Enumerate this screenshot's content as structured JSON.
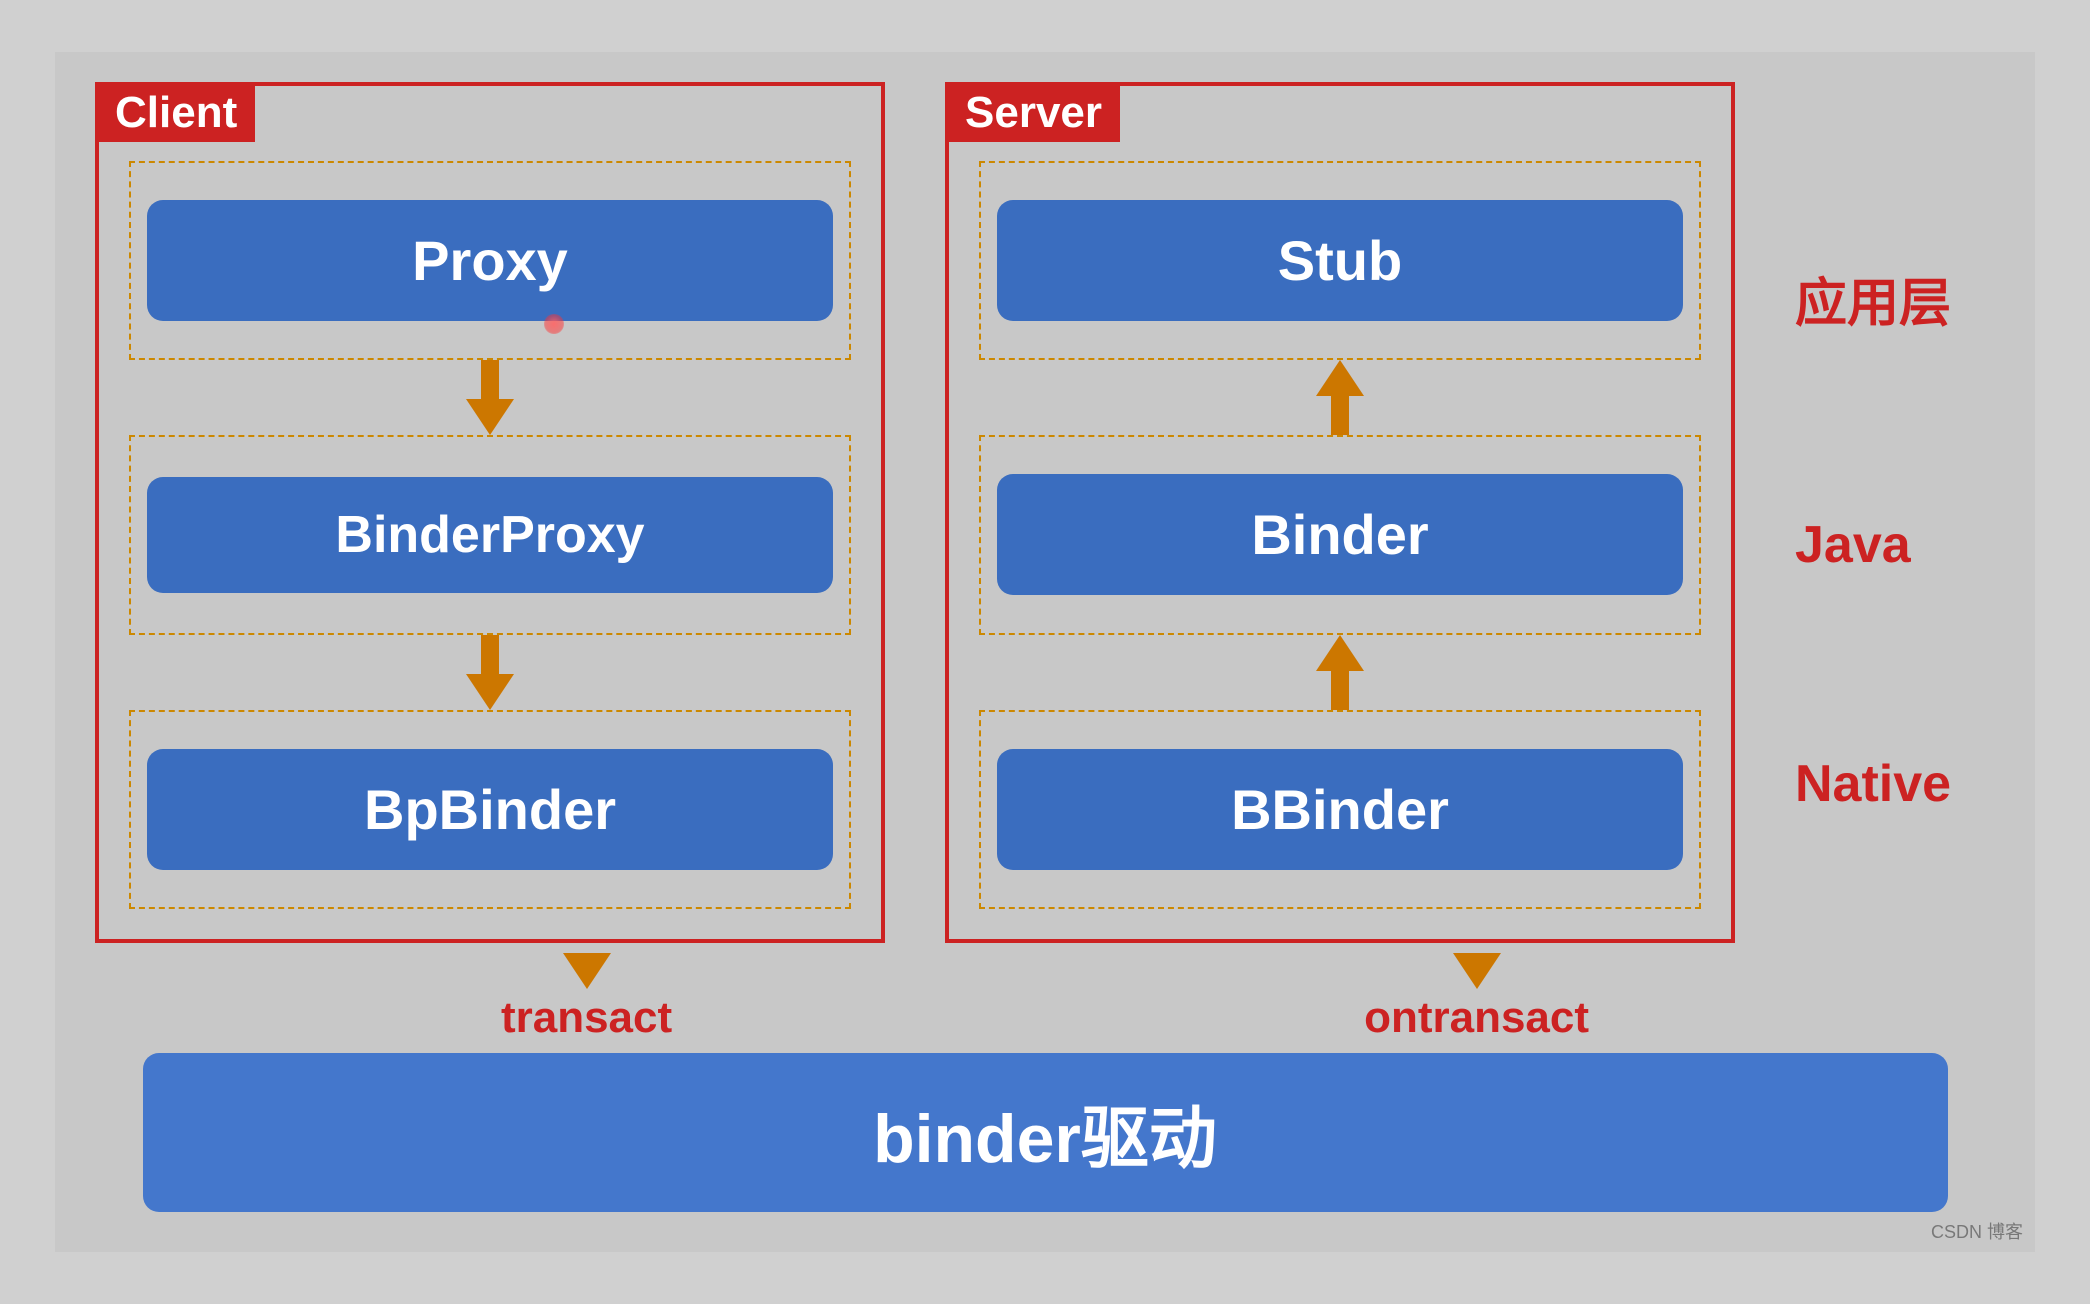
{
  "client": {
    "label": "Client",
    "proxy": "Proxy",
    "binderProxy": " binderProxy",
    "bpBinder": "BpBinder"
  },
  "server": {
    "label": "Server",
    "stub": "Stub",
    "binder": "Binder",
    "bbinder": "BBinder"
  },
  "layers": {
    "appLayer": "应用层",
    "java": "Java",
    "native": "Native"
  },
  "bottom": {
    "transact": "transact",
    "ontransact": "ontransact",
    "binderDriver": "binder驱动"
  },
  "watermark": "CSDN 博客"
}
